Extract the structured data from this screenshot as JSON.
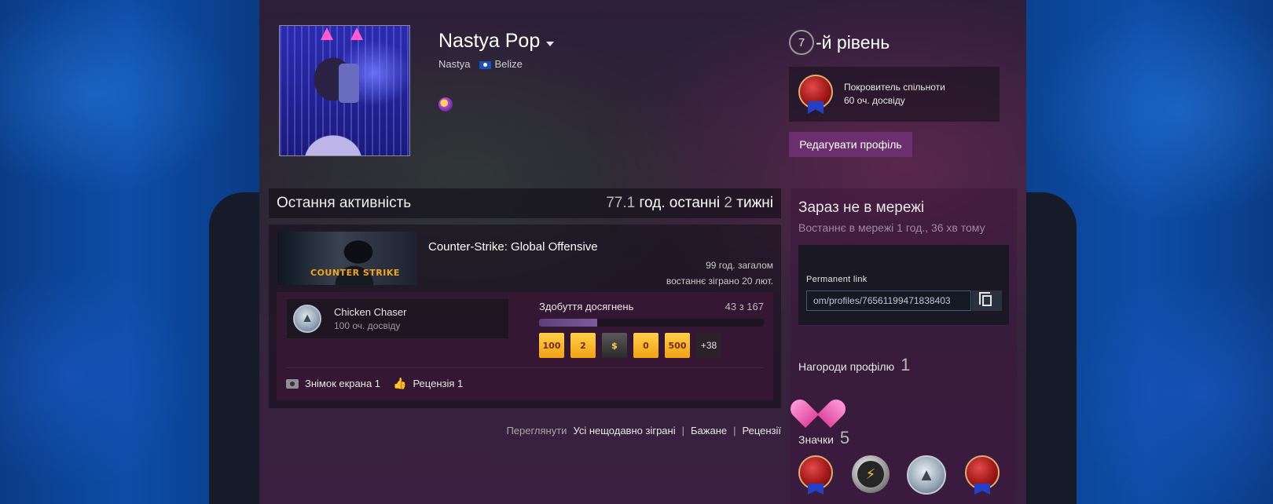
{
  "profile": {
    "persona_name": "Nastya Pop",
    "real_name": "Nastya",
    "country": "Belize",
    "level_number": "7",
    "level_suffix": "-й рівень",
    "favorite_badge": {
      "name": "Покровитель спільноти",
      "xp": "60 оч. досвіду"
    },
    "edit_button_label": "Редагувати профіль"
  },
  "activity": {
    "title": "Остання активність",
    "hours_value": "77.1",
    "hours_mid": " год. останні ",
    "weeks_value": "2",
    "weeks_suffix": " тижні",
    "game": {
      "name": "Counter-Strike: Global Offensive",
      "capsule_logo": "COUNTER STRIKE",
      "total_hours": "99 год. загалом",
      "last_played": "востаннє зіграно 20 лют.",
      "achievement": {
        "name": "Chicken Chaser",
        "xp": "100 оч. досвіду"
      },
      "progress_label": "Здобуття досягнень",
      "progress_count": "43 з 167",
      "progress_fraction": 0.257,
      "achievement_icons": [
        "100",
        "2",
        "$",
        "0",
        "500"
      ],
      "more_achievements": "+38",
      "screenshots_label": "Знімок екрана 1",
      "reviews_label": "Рецензія 1"
    },
    "view_links": {
      "label": "Переглянути",
      "all_recent": "Усі нещодавно зіграні",
      "wishlist": "Бажане",
      "reviews": "Рецензії"
    }
  },
  "sidebar": {
    "status_title": "Зараз не в мережі",
    "status_sub": "Востаннє в мережі 1 год., 36 хв тому",
    "permanent_link_label": "Permanent link",
    "permanent_link_value": "om/profiles/76561199471838403",
    "awards_label": "Нагороди профілю",
    "awards_count": "1",
    "badges_label": "Значки",
    "badges_count": "5"
  },
  "icons": {
    "caret": "chevron-down-icon",
    "copy": "copy-icon",
    "camera": "camera-icon",
    "thumb": "thumbs-up-icon"
  },
  "colors": {
    "edit_button": "#6b2f6d",
    "link_border": "#3c5c7c",
    "achievement_gold": "#f2a114"
  }
}
